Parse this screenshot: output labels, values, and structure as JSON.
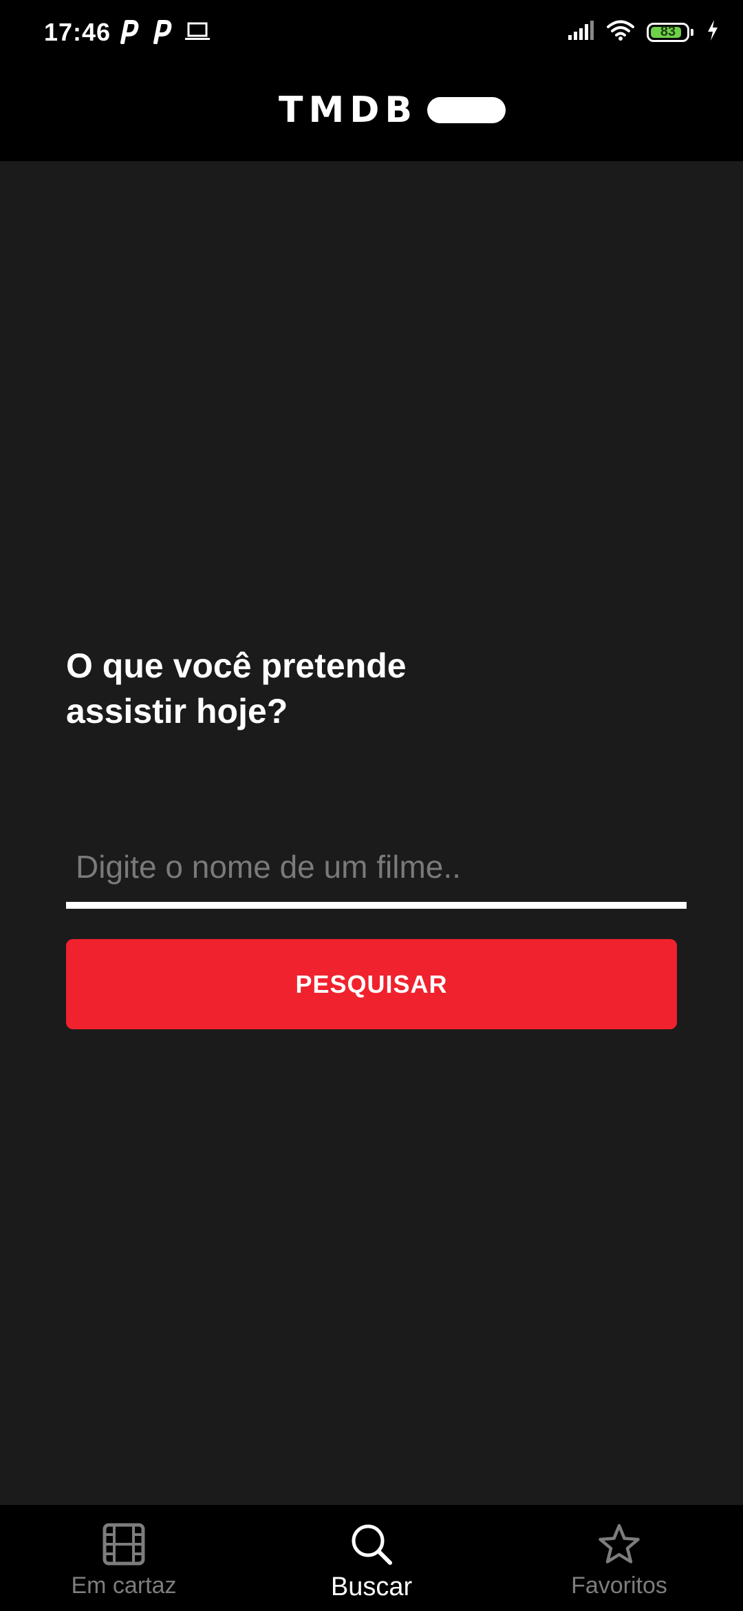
{
  "status_bar": {
    "time": "17:46",
    "battery": "83",
    "left_icons": [
      "parking-icon",
      "parking-icon",
      "laptop-icon"
    ],
    "right_icons": [
      "signal-icon",
      "wifi-icon",
      "battery-icon",
      "charging-icon"
    ]
  },
  "header": {
    "logo_text": "TMDB"
  },
  "main": {
    "headline": "O que você pretende assistir hoje?",
    "search": {
      "value": "",
      "placeholder": "Digite o nome de um filme.."
    },
    "search_button_label": "PESQUISAR",
    "accent_color": "#f0222e"
  },
  "bottom_nav": {
    "items": [
      {
        "label": "Em cartaz",
        "icon": "film-icon",
        "active": false
      },
      {
        "label": "Buscar",
        "icon": "search-icon",
        "active": true
      },
      {
        "label": "Favoritos",
        "icon": "star-icon",
        "active": false
      }
    ]
  }
}
